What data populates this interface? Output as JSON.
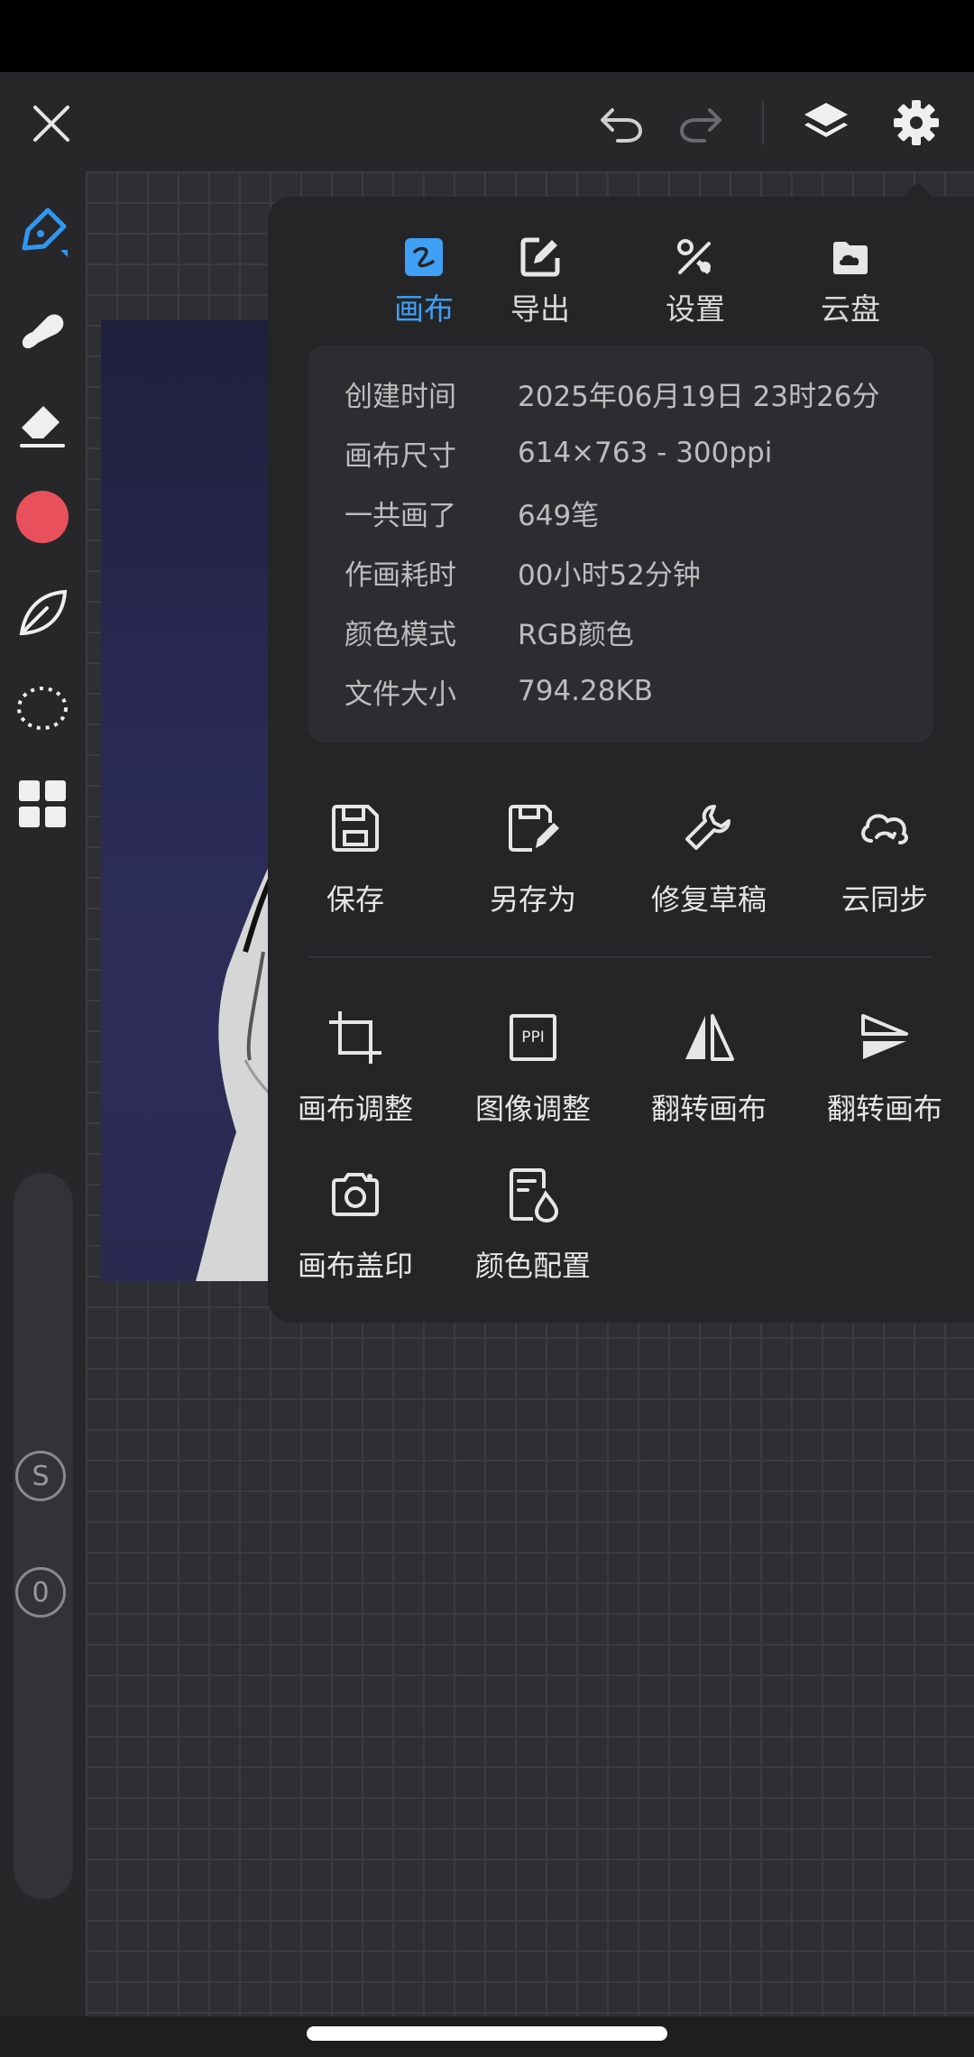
{
  "tabs": [
    {
      "label": "画布",
      "icon": "canvas-icon",
      "active": true
    },
    {
      "label": "导出",
      "icon": "export-icon",
      "active": false
    },
    {
      "label": "设置",
      "icon": "settings-tools-icon",
      "active": false
    },
    {
      "label": "云盘",
      "icon": "cloud-drive-icon",
      "active": false
    }
  ],
  "info": {
    "created": {
      "label": "创建时间",
      "value": "2025年06月19日 23时26分"
    },
    "size": {
      "label": "画布尺寸",
      "value": "614×763 - 300ppi"
    },
    "strokes": {
      "label": "一共画了",
      "value": "649笔"
    },
    "duration": {
      "label": "作画耗时",
      "value": "00小时52分钟"
    },
    "color_mode": {
      "label": "颜色模式",
      "value": "RGB颜色"
    },
    "file_size": {
      "label": "文件大小",
      "value": "794.28KB"
    }
  },
  "actions": {
    "save": "保存",
    "save_as": "另存为",
    "repair": "修复草稿",
    "cloud_sync": "云同步",
    "canvas_adjust": "画布调整",
    "image_adjust": "图像调整",
    "flip_h": "翻转画布",
    "flip_v": "翻转画布",
    "stamp": "画布盖印",
    "color_profile": "颜色配置"
  },
  "image_adjust_icon_text": "PPI",
  "sidebar": {
    "s_button": "S",
    "zero_button": "0"
  },
  "colors": {
    "accent": "#3fa0f5",
    "brush_color": "#e8505b",
    "panel_bg": "#252528",
    "info_bg": "#2d2d31"
  }
}
